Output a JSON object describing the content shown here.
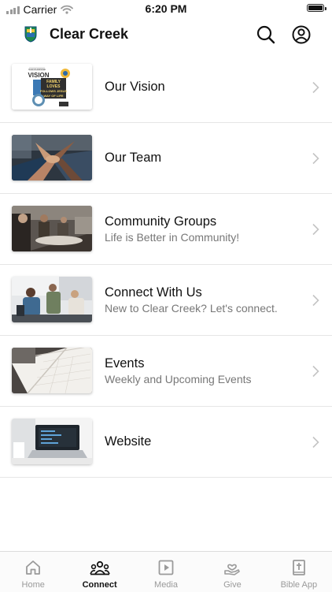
{
  "status_bar": {
    "carrier": "Carrier",
    "time": "6:20 PM"
  },
  "header": {
    "title": "Clear Creek"
  },
  "items": [
    {
      "title": "Our Vision",
      "subtitle": "",
      "thumb_text": {
        "small": "OUR PURPOSE",
        "heading": "VISION",
        "l1": "FAMILY",
        "l2": "LOVES",
        "l3": "FOLLOWS JESUS",
        "l4": "WAY OF LIFE"
      }
    },
    {
      "title": "Our Team",
      "subtitle": ""
    },
    {
      "title": "Community Groups",
      "subtitle": "Life is Better in Community!"
    },
    {
      "title": "Connect With Us",
      "subtitle": "New to Clear Creek? Let's connect."
    },
    {
      "title": "Events",
      "subtitle": "Weekly and Upcoming Events"
    },
    {
      "title": "Website",
      "subtitle": ""
    }
  ],
  "tabs": [
    {
      "label": "Home",
      "icon": "home-icon",
      "active": false
    },
    {
      "label": "Connect",
      "icon": "people-icon",
      "active": true
    },
    {
      "label": "Media",
      "icon": "play-icon",
      "active": false
    },
    {
      "label": "Give",
      "icon": "give-hand-icon",
      "active": false
    },
    {
      "label": "Bible App",
      "icon": "bible-icon",
      "active": false
    }
  ],
  "colors": {
    "active_tab": "#111111",
    "inactive_tab": "#9a9a9a",
    "subtitle": "#777777",
    "divider": "#e6e6e6"
  }
}
